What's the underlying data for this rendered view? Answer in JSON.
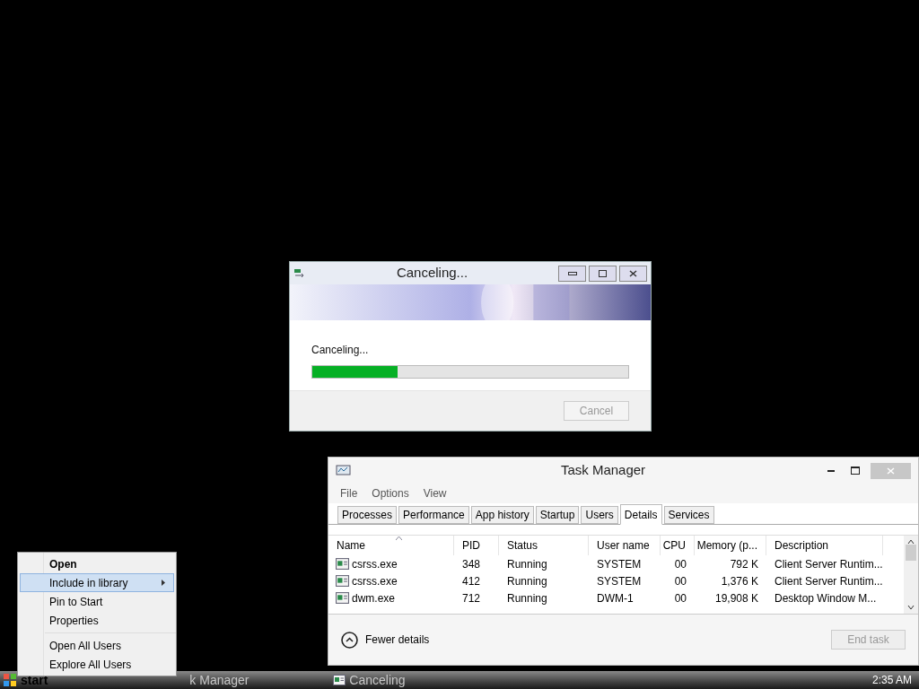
{
  "progress_dialog": {
    "title": "Canceling...",
    "message": "Canceling...",
    "progress": {
      "level": 0.27
    },
    "buttons": [
      {
        "label": "Cancel",
        "disabled": true
      }
    ]
  },
  "task_manager": {
    "title": "Task Manager",
    "menu": [
      "File",
      "Options",
      "View"
    ],
    "tabs": [
      {
        "label": "Processes",
        "selected": false
      },
      {
        "label": "Performance",
        "selected": false
      },
      {
        "label": "App history",
        "selected": false
      },
      {
        "label": "Startup",
        "selected": false
      },
      {
        "label": "Users",
        "selected": false
      },
      {
        "label": "Details",
        "selected": true
      },
      {
        "label": "Services",
        "selected": false
      }
    ],
    "table": {
      "columns": [
        "Name",
        "PID",
        "Status",
        "User name",
        "CPU",
        "Memory (p...",
        "Description"
      ],
      "rows": [
        [
          "csrss.exe",
          "348",
          "Running",
          "SYSTEM",
          "00",
          "792 K",
          "Client Server Runtim..."
        ],
        [
          "csrss.exe",
          "412",
          "Running",
          "SYSTEM",
          "00",
          "1,376 K",
          "Client Server Runtim..."
        ],
        [
          "dwm.exe",
          "712",
          "Running",
          "DWM-1",
          "00",
          "19,908 K",
          "Desktop Window M..."
        ]
      ]
    },
    "fewer_details": "Fewer details",
    "end_task": {
      "label": "End task",
      "disabled": true
    }
  },
  "context_menu": {
    "items": [
      {
        "label": "Open",
        "kind": "default",
        "selected": false
      },
      {
        "label": "Include in library",
        "kind": "submenu",
        "selected": true
      },
      {
        "label": "Pin to Start",
        "kind": "item",
        "selected": false
      },
      {
        "label": "Properties",
        "kind": "item",
        "selected": false
      },
      {
        "label": "Open All Users",
        "kind": "item",
        "selected": false
      },
      {
        "label": "Explore All Users",
        "kind": "item",
        "selected": false
      }
    ]
  },
  "taskbar": {
    "start": "start",
    "items": [
      "k Manager",
      "Canceling"
    ],
    "clock": "2:35 AM"
  }
}
